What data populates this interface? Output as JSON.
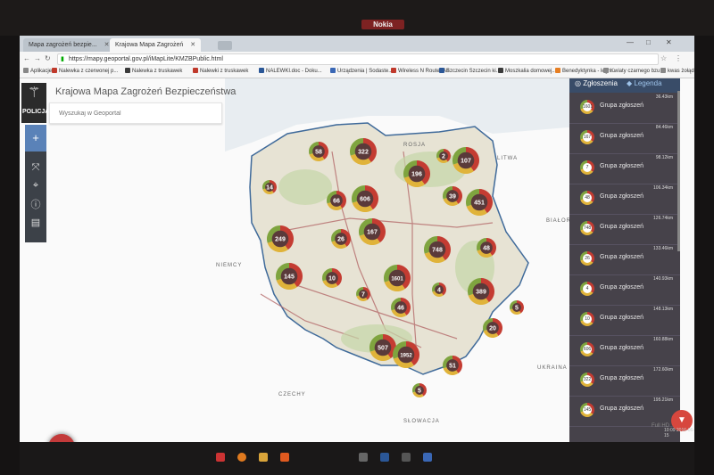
{
  "browser": {
    "tabs": [
      {
        "label": "Mapa zagrożeń bezpie...",
        "active": false
      },
      {
        "label": "Krajowa Mapa Zagrożeń",
        "active": true
      }
    ],
    "url": "https://mapy.geoportal.gov.pl/iMapLite/KMZBPublic.html",
    "bookmarks": [
      {
        "label": "Aplikacje",
        "color": "#888888"
      },
      {
        "label": "Nalewka z czerwonej p...",
        "color": "#c0392b"
      },
      {
        "label": "Nalewka z truskawek",
        "color": "#3a3a3a"
      },
      {
        "label": "Nalewki z truskawek",
        "color": "#c0392b"
      },
      {
        "label": "NALEWKI.doc - Doku...",
        "color": "#2b5797"
      },
      {
        "label": "Urządzenia | Sodaste...",
        "color": "#3a67b5"
      },
      {
        "label": "Wireless N Router All",
        "color": "#c0392b"
      },
      {
        "label": "Szczecin Szczecin ki...",
        "color": "#2b5797"
      },
      {
        "label": "Moszkalia domowej...",
        "color": "#3a3a3a"
      },
      {
        "label": "Benedyktynka - legn...",
        "color": "#e67e22"
      },
      {
        "label": "Kwiaty czarnego bzu",
        "color": "#888888"
      },
      {
        "label": "kwas żołądka",
        "color": "#888888"
      }
    ]
  },
  "app": {
    "title": "Krajowa Mapa Zagrożeń Bezpieczeństwa",
    "logo_text": "POLICJA",
    "search_placeholder": "Wyszukaj w Geoportal"
  },
  "map": {
    "countries": [
      {
        "name": "ROSJA",
        "pos": "top"
      },
      {
        "name": "LITWA",
        "pos": "top-right"
      },
      {
        "name": "BIAŁORUŚ",
        "pos": "right"
      },
      {
        "name": "NIEMCY",
        "pos": "left"
      },
      {
        "name": "UKRAINA",
        "pos": "bottom-right"
      },
      {
        "name": "CZECHY",
        "pos": "bottom-left"
      },
      {
        "name": "SŁOWACJA",
        "pos": "bottom"
      }
    ],
    "clusters": [
      {
        "label": "58",
        "size": "m"
      },
      {
        "label": "322",
        "size": "l"
      },
      {
        "label": "2",
        "size": "s"
      },
      {
        "label": "107",
        "size": "l"
      },
      {
        "label": "196",
        "size": "l"
      },
      {
        "label": "14",
        "size": "s"
      },
      {
        "label": "66",
        "size": "m"
      },
      {
        "label": "606",
        "size": "l"
      },
      {
        "label": "39",
        "size": "m"
      },
      {
        "label": "451",
        "size": "l"
      },
      {
        "label": "249",
        "size": "l"
      },
      {
        "label": "26",
        "size": "m"
      },
      {
        "label": "167",
        "size": "l"
      },
      {
        "label": "748",
        "size": "l"
      },
      {
        "label": "48",
        "size": "m"
      },
      {
        "label": "145",
        "size": "l"
      },
      {
        "label": "10",
        "size": "m"
      },
      {
        "label": "1601",
        "size": "l"
      },
      {
        "label": "4",
        "size": "s"
      },
      {
        "label": "389",
        "size": "l"
      },
      {
        "label": "7",
        "size": "s"
      },
      {
        "label": "46",
        "size": "m"
      },
      {
        "label": "5",
        "size": "s"
      },
      {
        "label": "20",
        "size": "m"
      },
      {
        "label": "507",
        "size": "l"
      },
      {
        "label": "1952",
        "size": "l"
      },
      {
        "label": "51",
        "size": "m"
      },
      {
        "label": "5",
        "size": "s"
      }
    ]
  },
  "panel": {
    "tab_reports": "Zgłoszenia",
    "tab_legend": "Legenda",
    "items": [
      {
        "count": "1601",
        "label": "Grupa zgłoszeń",
        "dist": "36.43km"
      },
      {
        "count": "167",
        "label": "Grupa zgłoszeń",
        "dist": "84.46km"
      },
      {
        "count": "7",
        "label": "Grupa zgłoszeń",
        "dist": "98.12km"
      },
      {
        "count": "48",
        "label": "Grupa zgłoszeń",
        "dist": "106.34km"
      },
      {
        "count": "748",
        "label": "Grupa zgłoszeń",
        "dist": "126.74km"
      },
      {
        "count": "26",
        "label": "Grupa zgłoszeń",
        "dist": "133.46km"
      },
      {
        "count": "4",
        "label": "Grupa zgłoszeń",
        "dist": "140.93km"
      },
      {
        "count": "10",
        "label": "Grupa zgłoszeń",
        "dist": "148.13km"
      },
      {
        "count": "606",
        "label": "Grupa zgłoszeń",
        "dist": "160.88km"
      },
      {
        "count": "322",
        "label": "Grupa zgłoszeń",
        "dist": "172.60km"
      },
      {
        "count": "145",
        "label": "Grupa zgłoszeń",
        "dist": "195.21km"
      }
    ],
    "clock": "10:09 2016-06-15"
  },
  "colors": {
    "red": "#c43c32",
    "yellow": "#e0b33a",
    "green": "#7fa43f",
    "panel": "#46424a",
    "panel_header": "#394c68",
    "fab": "#c33a3a"
  },
  "fab_label": "+",
  "icons": [
    "plus-icon",
    "expand-icon",
    "crosshair-icon",
    "info-icon",
    "layers-icon",
    "filter-icon"
  ],
  "monitor_brand": "Nokia",
  "bezel_label": "Full HD"
}
